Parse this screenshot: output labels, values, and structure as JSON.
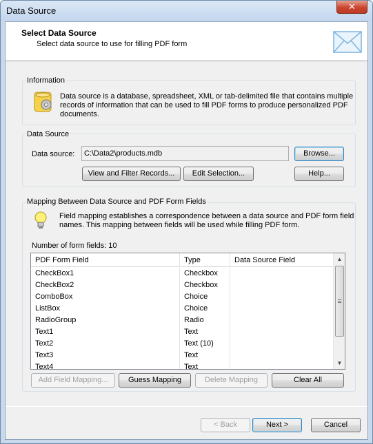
{
  "window": {
    "title": "Data Source",
    "close_glyph": "✕"
  },
  "header": {
    "title": "Select Data Source",
    "subtitle": "Select data source to use for filling PDF form",
    "icon": "envelope-icon"
  },
  "information": {
    "label": "Information",
    "text_line1": "Data source is a database, spreadsheet, XML or tab-delimited file that contains multiple",
    "text_line2": "records of information that can be used to fill PDF forms to produce personalized PDF",
    "text_line3": "documents.",
    "icon": "database-gear-icon"
  },
  "data_source": {
    "label": "Data Source",
    "field_label": "Data source:",
    "value": "C:\\Data2\\products.mdb",
    "browse_label": "Browse...",
    "view_filter_label": "View and Filter Records...",
    "edit_selection_label": "Edit Selection...",
    "help_label": "Help..."
  },
  "mapping": {
    "label": "Mapping Between Data Source and PDF Form Fields",
    "text_line1": "Field mapping establishes a correspondence between a data source and PDF form field",
    "text_line2": "names. This mapping between fields will be used while filling PDF form.",
    "icon": "lightbulb-icon",
    "count_label": "Number of form fields: 10",
    "columns": [
      "PDF Form Field",
      "Type",
      "Data Source Field"
    ],
    "rows": [
      {
        "field": "CheckBox1",
        "type": "Checkbox",
        "source": ""
      },
      {
        "field": "CheckBox2",
        "type": "Checkbox",
        "source": ""
      },
      {
        "field": "ComboBox",
        "type": "Choice",
        "source": ""
      },
      {
        "field": "ListBox",
        "type": "Choice",
        "source": ""
      },
      {
        "field": "RadioGroup",
        "type": "Radio",
        "source": ""
      },
      {
        "field": "Text1",
        "type": "Text",
        "source": ""
      },
      {
        "field": "Text2",
        "type": "Text (10)",
        "source": ""
      },
      {
        "field": "Text3",
        "type": "Text",
        "source": ""
      },
      {
        "field": "Text4",
        "type": "Text",
        "source": ""
      }
    ],
    "add_label": "Add Field Mapping...",
    "guess_label": "Guess Mapping",
    "delete_label": "Delete Mapping",
    "clear_label": "Clear All"
  },
  "footer": {
    "back_label": "< Back",
    "next_label": "Next >",
    "cancel_label": "Cancel"
  }
}
